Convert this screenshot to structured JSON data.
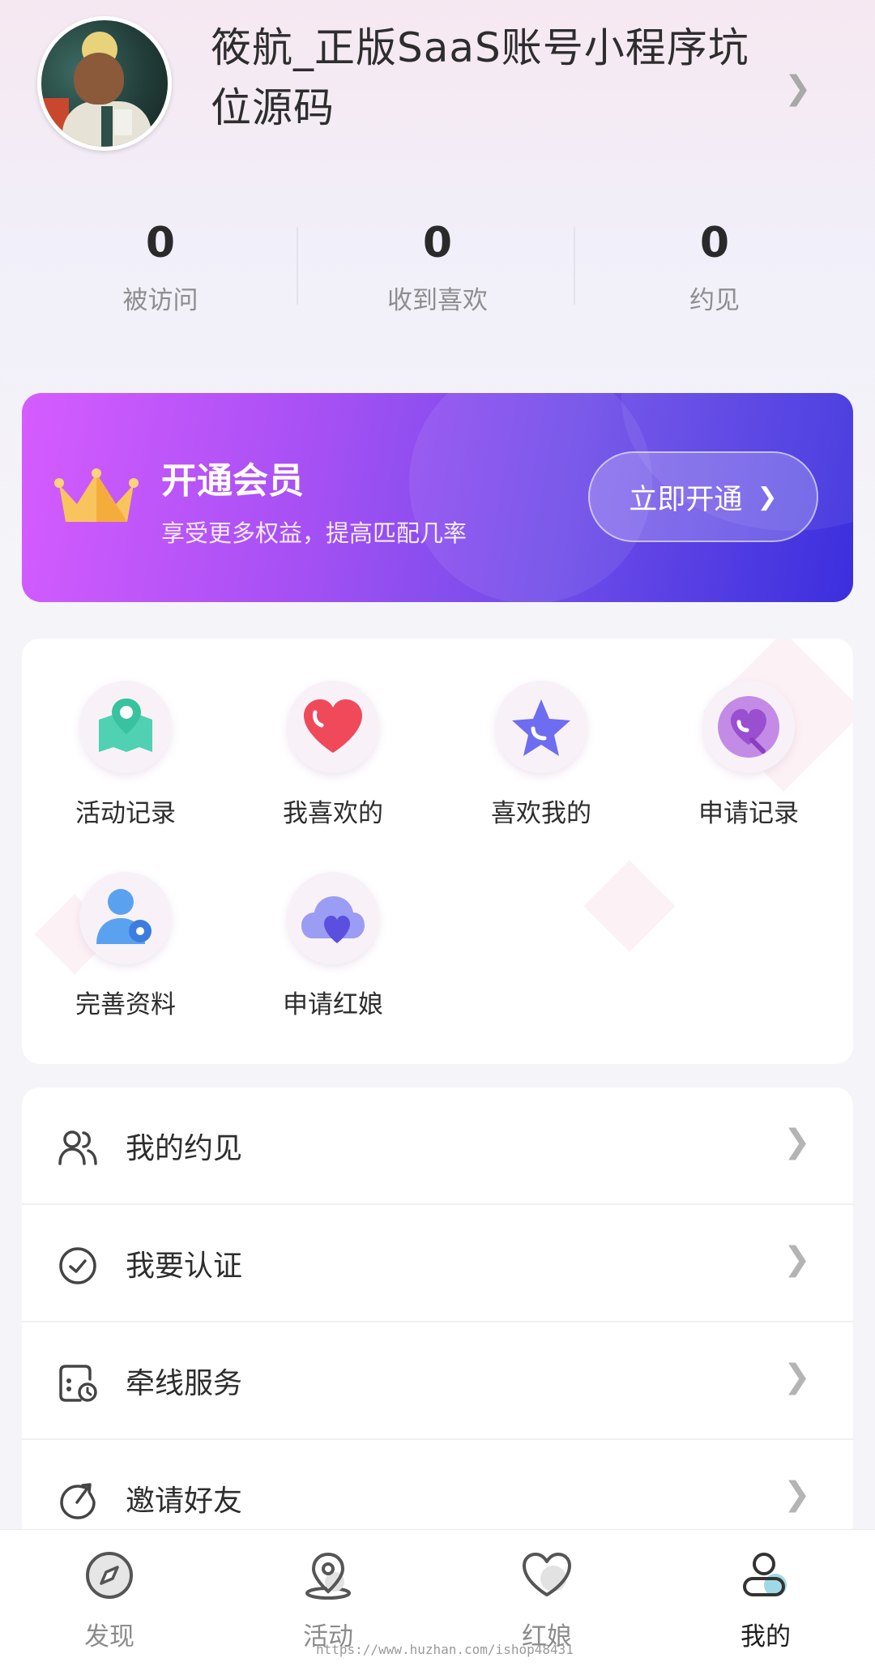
{
  "profile": {
    "name": "筱航_正版SaaS账号小程序坑位源码"
  },
  "stats": [
    {
      "value": "0",
      "label": "被访问"
    },
    {
      "value": "0",
      "label": "收到喜欢"
    },
    {
      "value": "0",
      "label": "约见"
    }
  ],
  "vip": {
    "title": "开通会员",
    "subtitle": "享受更多权益，提高匹配几率",
    "button": "立即开通"
  },
  "grid": [
    {
      "label": "活动记录",
      "icon": "map-pin-icon"
    },
    {
      "label": "我喜欢的",
      "icon": "heart-icon"
    },
    {
      "label": "喜欢我的",
      "icon": "star-icon"
    },
    {
      "label": "申请记录",
      "icon": "heart-balloon-icon"
    },
    {
      "label": "完善资料",
      "icon": "user-edit-icon"
    },
    {
      "label": "申请红娘",
      "icon": "cloud-heart-icon"
    }
  ],
  "menu": [
    {
      "label": "我的约见",
      "icon": "users-icon"
    },
    {
      "label": "我要认证",
      "icon": "check-circle-icon"
    },
    {
      "label": "牵线服务",
      "icon": "clock-card-icon"
    },
    {
      "label": "邀请好友",
      "icon": "invite-icon"
    }
  ],
  "tabs": [
    {
      "label": "发现",
      "icon": "compass-icon"
    },
    {
      "label": "活动",
      "icon": "location-icon"
    },
    {
      "label": "红娘",
      "icon": "heart-outline-icon"
    },
    {
      "label": "我的",
      "icon": "profile-icon"
    }
  ],
  "watermark": "https://www.huzhan.com/ishop48431",
  "colors": {
    "vip_start": "#d65cff",
    "vip_end": "#3b2fdd",
    "accent_teal": "#4fd1b2",
    "accent_red": "#f0495a",
    "accent_blue": "#6e6cf0",
    "accent_purple": "#b06fe0"
  }
}
